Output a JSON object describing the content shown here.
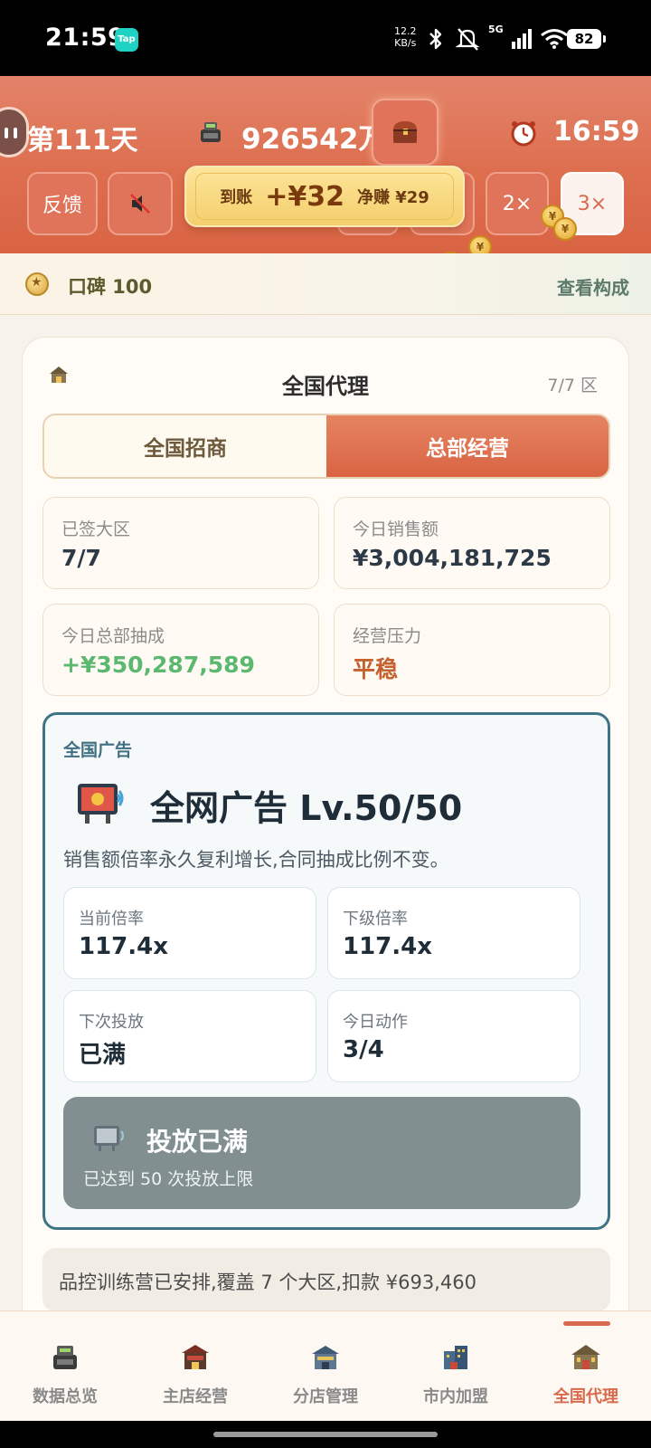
{
  "status_bar": {
    "time": "21:59",
    "app_badge": "Tap",
    "net_speed_value": "12.2",
    "net_speed_unit": "KB/s",
    "signal_label": "5G",
    "battery": "82"
  },
  "header": {
    "day": "第111天",
    "money": "926542万",
    "clock": "16:59",
    "buttons": {
      "feedback": "反馈",
      "speed_2x": "2×",
      "speed_3x": "3×"
    },
    "toast": {
      "arrival_label": "到账",
      "arrival_amount": "+¥32",
      "net_label": "净赚 ¥29"
    },
    "coin_symbol": "¥"
  },
  "reputation": {
    "label": "口碑 100",
    "link": "查看构成"
  },
  "panel": {
    "title": "全国代理",
    "region_count": "7/7 区",
    "tabs": [
      {
        "label": "全国招商",
        "active": false
      },
      {
        "label": "总部经营",
        "active": true
      }
    ],
    "stats": [
      {
        "label": "已签大区",
        "value": "7/7"
      },
      {
        "label": "今日销售额",
        "value": "¥3,004,181,725"
      },
      {
        "label": "今日总部抽成",
        "value": "+¥350,287,589"
      },
      {
        "label": "经营压力",
        "value": "平稳"
      }
    ],
    "ad": {
      "section": "全国广告",
      "title": "全网广告 Lv.50/50",
      "desc": "销售额倍率永久复利增长,合同抽成比例不变。",
      "stats": [
        {
          "label": "当前倍率",
          "value": "117.4x"
        },
        {
          "label": "下级倍率",
          "value": "117.4x"
        },
        {
          "label": "下次投放",
          "value": "已满"
        },
        {
          "label": "今日动作",
          "value": "3/4"
        }
      ],
      "button_title": "投放已满",
      "button_sub": "已达到 50 次投放上限"
    },
    "notice": "品控训练营已安排,覆盖 7 个大区,扣款 ¥693,460"
  },
  "nav": {
    "items": [
      {
        "label": "数据总览",
        "icon": "cash-register-icon"
      },
      {
        "label": "主店经营",
        "icon": "main-store-icon"
      },
      {
        "label": "分店管理",
        "icon": "branch-store-icon"
      },
      {
        "label": "市内加盟",
        "icon": "city-franchise-icon"
      },
      {
        "label": "全国代理",
        "icon": "national-agency-icon"
      }
    ],
    "active_index": 4
  },
  "colors": {
    "accent": "#d9694c",
    "header_bg": "#dd6e4e",
    "ad_border": "#3f7487",
    "positive": "#5cb870",
    "disabled_button": "#818f90"
  }
}
